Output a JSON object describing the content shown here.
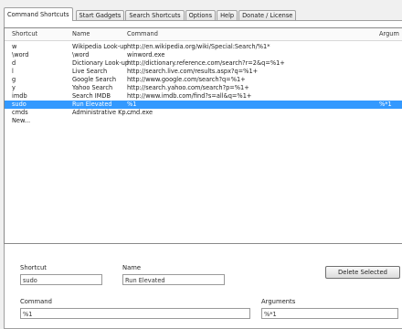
{
  "tabs": [
    {
      "label": "Command Shortcuts",
      "active": true
    },
    {
      "label": "Start Gadgets",
      "active": false
    },
    {
      "label": "Search Shortcuts",
      "active": false
    },
    {
      "label": "Options",
      "active": false
    },
    {
      "label": "Help",
      "active": false
    },
    {
      "label": "Donate / License",
      "active": false
    }
  ],
  "list": {
    "columns": {
      "shortcut": "Shortcut",
      "name": "Name",
      "command": "Command",
      "arguments": "Argum"
    },
    "rows": [
      {
        "shortcut": "w",
        "name": "Wikipedia Look-up",
        "command": "http://en.wikipedia.org/wiki/Special:Search/%1*",
        "arguments": "",
        "selected": false
      },
      {
        "shortcut": "\\word",
        "name": "\\word",
        "command": "winword.exe",
        "arguments": "",
        "selected": false
      },
      {
        "shortcut": "d",
        "name": "Dictionary Look-up",
        "command": "http://dictionary.reference.com/search?r=2&q=%1+",
        "arguments": "",
        "selected": false
      },
      {
        "shortcut": "l",
        "name": "Live Search",
        "command": "http://search.live.com/results.aspx?q=%1+",
        "arguments": "",
        "selected": false
      },
      {
        "shortcut": "g",
        "name": "Google Search",
        "command": "http://www.google.com/search?q=%1+",
        "arguments": "",
        "selected": false
      },
      {
        "shortcut": "y",
        "name": "Yahoo Search",
        "command": "http://search.yahoo.com/search?p=%1+",
        "arguments": "",
        "selected": false
      },
      {
        "shortcut": "imdb",
        "name": "Search IMDB",
        "command": "http://www.imdb.com/find?s=all&q=%1+",
        "arguments": "",
        "selected": false
      },
      {
        "shortcut": "sudo",
        "name": "Run Elevated",
        "command": "%1",
        "arguments": "%*1",
        "selected": true
      },
      {
        "shortcut": "cmds",
        "name": "Administrative Kp...",
        "command": "cmd.exe",
        "arguments": "",
        "selected": false
      },
      {
        "shortcut": "New...",
        "name": "",
        "command": "",
        "arguments": "",
        "selected": false
      }
    ]
  },
  "form": {
    "shortcut_label": "Shortcut",
    "shortcut_value": "sudo",
    "name_label": "Name",
    "name_value": "Run Elevated",
    "command_label": "Command",
    "command_value": "%1",
    "arguments_label": "Arguments",
    "arguments_value": "%*1",
    "delete_button": "Delete Selected"
  },
  "colors": {
    "selection": "#3399ff"
  }
}
